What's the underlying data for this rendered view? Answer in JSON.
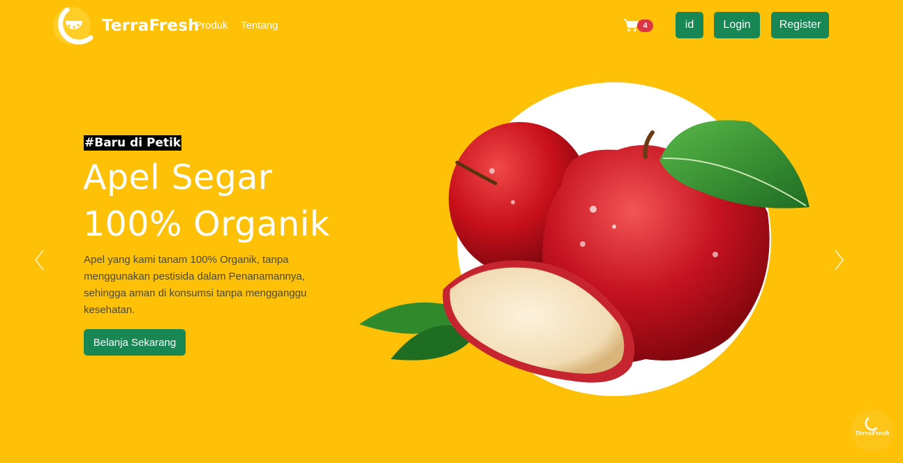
{
  "navbar": {
    "brand": "TerraFresh",
    "links": [
      {
        "label": "Produk"
      },
      {
        "label": "Tentang"
      }
    ],
    "cart_count": "4",
    "lang_button": "id",
    "login_button": "Login",
    "register_button": "Register"
  },
  "hero": {
    "tag": "#Baru di Petik",
    "headline_line1": "Apel Segar",
    "headline_line2": "100% Organik",
    "description": "Apel yang kami tanam 100% Organik, tanpa menggunakan pestisida dalam Penanamannya, sehingga aman di konsumsi tanpa mengganggu kesehatan.",
    "cta": "Belanja Sekarang"
  },
  "float_badge": {
    "text": "TerraFresh"
  },
  "icons": {
    "cart": "cart-icon",
    "prev": "chevron-left-icon",
    "next": "chevron-right-icon"
  },
  "colors": {
    "background": "#FFC107",
    "primary_button": "#198754",
    "badge": "#dc3545"
  }
}
